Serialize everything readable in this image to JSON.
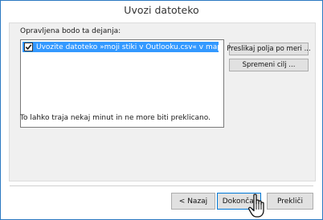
{
  "window": {
    "title": "Uvozi datoteko"
  },
  "main": {
    "actions_label": "Opravljena bodo ta dejanja:",
    "list_items": [
      {
        "checked": true,
        "text": "Uvozite datoteko »moji stiki v Outlooku.csv« v mapo:"
      }
    ],
    "map_fields_button": "Preslikaj polja po meri ...",
    "change_destination_button": "Spremeni cilj ...",
    "note": "To lahko traja nekaj minut in ne more biti preklicano."
  },
  "footer": {
    "back_button": "< Nazaj",
    "finish_button": "Dokončaj",
    "cancel_button": "Prekliči"
  },
  "icons": {
    "checkmark": "checkmark-icon",
    "cursor": "hand-pointer-icon"
  },
  "colors": {
    "selection": "#3399ff",
    "window_border": "#2b79c2",
    "panel_background": "#f0f0f0",
    "button_background": "#e1e1e1"
  }
}
